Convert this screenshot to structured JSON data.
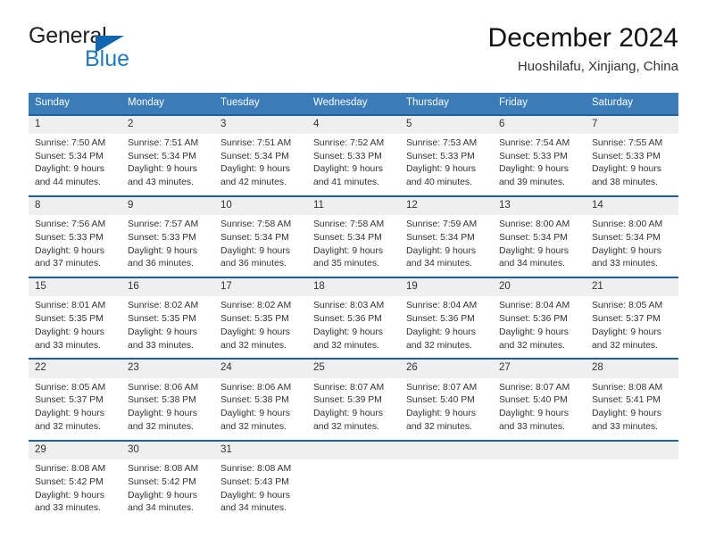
{
  "brand": {
    "name_top": "General",
    "name_bottom": "Blue",
    "accent_color": "#1f7ac0",
    "triangle_color": "#0f67b1"
  },
  "header": {
    "title": "December 2024",
    "subtitle": "Huoshilafu, Xinjiang, China",
    "header_bg": "#3a7cb8",
    "row_divider_color": "#1f5fa0",
    "daynum_bg": "#efefef"
  },
  "weekdays": [
    "Sunday",
    "Monday",
    "Tuesday",
    "Wednesday",
    "Thursday",
    "Friday",
    "Saturday"
  ],
  "weeks": [
    [
      {
        "day": "1",
        "sunrise": "Sunrise: 7:50 AM",
        "sunset": "Sunset: 5:34 PM",
        "daylight1": "Daylight: 9 hours",
        "daylight2": "and 44 minutes."
      },
      {
        "day": "2",
        "sunrise": "Sunrise: 7:51 AM",
        "sunset": "Sunset: 5:34 PM",
        "daylight1": "Daylight: 9 hours",
        "daylight2": "and 43 minutes."
      },
      {
        "day": "3",
        "sunrise": "Sunrise: 7:51 AM",
        "sunset": "Sunset: 5:34 PM",
        "daylight1": "Daylight: 9 hours",
        "daylight2": "and 42 minutes."
      },
      {
        "day": "4",
        "sunrise": "Sunrise: 7:52 AM",
        "sunset": "Sunset: 5:33 PM",
        "daylight1": "Daylight: 9 hours",
        "daylight2": "and 41 minutes."
      },
      {
        "day": "5",
        "sunrise": "Sunrise: 7:53 AM",
        "sunset": "Sunset: 5:33 PM",
        "daylight1": "Daylight: 9 hours",
        "daylight2": "and 40 minutes."
      },
      {
        "day": "6",
        "sunrise": "Sunrise: 7:54 AM",
        "sunset": "Sunset: 5:33 PM",
        "daylight1": "Daylight: 9 hours",
        "daylight2": "and 39 minutes."
      },
      {
        "day": "7",
        "sunrise": "Sunrise: 7:55 AM",
        "sunset": "Sunset: 5:33 PM",
        "daylight1": "Daylight: 9 hours",
        "daylight2": "and 38 minutes."
      }
    ],
    [
      {
        "day": "8",
        "sunrise": "Sunrise: 7:56 AM",
        "sunset": "Sunset: 5:33 PM",
        "daylight1": "Daylight: 9 hours",
        "daylight2": "and 37 minutes."
      },
      {
        "day": "9",
        "sunrise": "Sunrise: 7:57 AM",
        "sunset": "Sunset: 5:33 PM",
        "daylight1": "Daylight: 9 hours",
        "daylight2": "and 36 minutes."
      },
      {
        "day": "10",
        "sunrise": "Sunrise: 7:58 AM",
        "sunset": "Sunset: 5:34 PM",
        "daylight1": "Daylight: 9 hours",
        "daylight2": "and 36 minutes."
      },
      {
        "day": "11",
        "sunrise": "Sunrise: 7:58 AM",
        "sunset": "Sunset: 5:34 PM",
        "daylight1": "Daylight: 9 hours",
        "daylight2": "and 35 minutes."
      },
      {
        "day": "12",
        "sunrise": "Sunrise: 7:59 AM",
        "sunset": "Sunset: 5:34 PM",
        "daylight1": "Daylight: 9 hours",
        "daylight2": "and 34 minutes."
      },
      {
        "day": "13",
        "sunrise": "Sunrise: 8:00 AM",
        "sunset": "Sunset: 5:34 PM",
        "daylight1": "Daylight: 9 hours",
        "daylight2": "and 34 minutes."
      },
      {
        "day": "14",
        "sunrise": "Sunrise: 8:00 AM",
        "sunset": "Sunset: 5:34 PM",
        "daylight1": "Daylight: 9 hours",
        "daylight2": "and 33 minutes."
      }
    ],
    [
      {
        "day": "15",
        "sunrise": "Sunrise: 8:01 AM",
        "sunset": "Sunset: 5:35 PM",
        "daylight1": "Daylight: 9 hours",
        "daylight2": "and 33 minutes."
      },
      {
        "day": "16",
        "sunrise": "Sunrise: 8:02 AM",
        "sunset": "Sunset: 5:35 PM",
        "daylight1": "Daylight: 9 hours",
        "daylight2": "and 33 minutes."
      },
      {
        "day": "17",
        "sunrise": "Sunrise: 8:02 AM",
        "sunset": "Sunset: 5:35 PM",
        "daylight1": "Daylight: 9 hours",
        "daylight2": "and 32 minutes."
      },
      {
        "day": "18",
        "sunrise": "Sunrise: 8:03 AM",
        "sunset": "Sunset: 5:36 PM",
        "daylight1": "Daylight: 9 hours",
        "daylight2": "and 32 minutes."
      },
      {
        "day": "19",
        "sunrise": "Sunrise: 8:04 AM",
        "sunset": "Sunset: 5:36 PM",
        "daylight1": "Daylight: 9 hours",
        "daylight2": "and 32 minutes."
      },
      {
        "day": "20",
        "sunrise": "Sunrise: 8:04 AM",
        "sunset": "Sunset: 5:36 PM",
        "daylight1": "Daylight: 9 hours",
        "daylight2": "and 32 minutes."
      },
      {
        "day": "21",
        "sunrise": "Sunrise: 8:05 AM",
        "sunset": "Sunset: 5:37 PM",
        "daylight1": "Daylight: 9 hours",
        "daylight2": "and 32 minutes."
      }
    ],
    [
      {
        "day": "22",
        "sunrise": "Sunrise: 8:05 AM",
        "sunset": "Sunset: 5:37 PM",
        "daylight1": "Daylight: 9 hours",
        "daylight2": "and 32 minutes."
      },
      {
        "day": "23",
        "sunrise": "Sunrise: 8:06 AM",
        "sunset": "Sunset: 5:38 PM",
        "daylight1": "Daylight: 9 hours",
        "daylight2": "and 32 minutes."
      },
      {
        "day": "24",
        "sunrise": "Sunrise: 8:06 AM",
        "sunset": "Sunset: 5:38 PM",
        "daylight1": "Daylight: 9 hours",
        "daylight2": "and 32 minutes."
      },
      {
        "day": "25",
        "sunrise": "Sunrise: 8:07 AM",
        "sunset": "Sunset: 5:39 PM",
        "daylight1": "Daylight: 9 hours",
        "daylight2": "and 32 minutes."
      },
      {
        "day": "26",
        "sunrise": "Sunrise: 8:07 AM",
        "sunset": "Sunset: 5:40 PM",
        "daylight1": "Daylight: 9 hours",
        "daylight2": "and 32 minutes."
      },
      {
        "day": "27",
        "sunrise": "Sunrise: 8:07 AM",
        "sunset": "Sunset: 5:40 PM",
        "daylight1": "Daylight: 9 hours",
        "daylight2": "and 33 minutes."
      },
      {
        "day": "28",
        "sunrise": "Sunrise: 8:08 AM",
        "sunset": "Sunset: 5:41 PM",
        "daylight1": "Daylight: 9 hours",
        "daylight2": "and 33 minutes."
      }
    ],
    [
      {
        "day": "29",
        "sunrise": "Sunrise: 8:08 AM",
        "sunset": "Sunset: 5:42 PM",
        "daylight1": "Daylight: 9 hours",
        "daylight2": "and 33 minutes."
      },
      {
        "day": "30",
        "sunrise": "Sunrise: 8:08 AM",
        "sunset": "Sunset: 5:42 PM",
        "daylight1": "Daylight: 9 hours",
        "daylight2": "and 34 minutes."
      },
      {
        "day": "31",
        "sunrise": "Sunrise: 8:08 AM",
        "sunset": "Sunset: 5:43 PM",
        "daylight1": "Daylight: 9 hours",
        "daylight2": "and 34 minutes."
      },
      {
        "day": "",
        "sunrise": "",
        "sunset": "",
        "daylight1": "",
        "daylight2": ""
      },
      {
        "day": "",
        "sunrise": "",
        "sunset": "",
        "daylight1": "",
        "daylight2": ""
      },
      {
        "day": "",
        "sunrise": "",
        "sunset": "",
        "daylight1": "",
        "daylight2": ""
      },
      {
        "day": "",
        "sunrise": "",
        "sunset": "",
        "daylight1": "",
        "daylight2": ""
      }
    ]
  ]
}
